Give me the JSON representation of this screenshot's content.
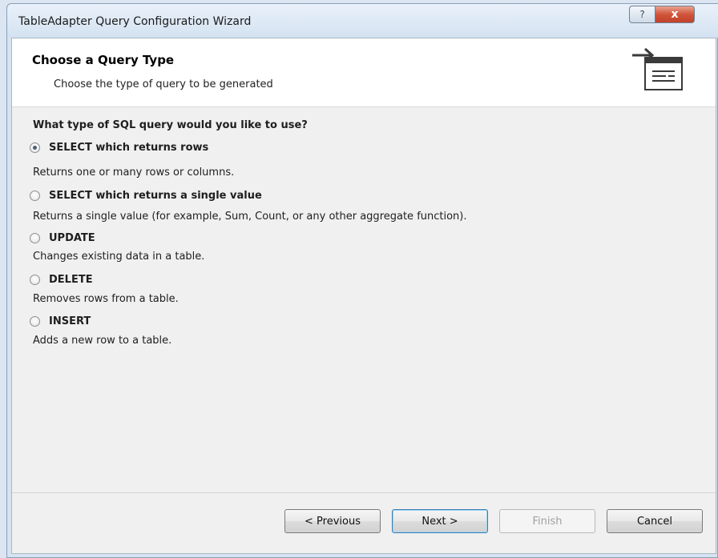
{
  "window": {
    "title": "TableAdapter Query Configuration Wizard",
    "help_glyph": "?",
    "close_glyph": "x"
  },
  "header": {
    "title": "Choose a Query Type",
    "subtitle": "Choose the type of query to be generated",
    "icon": "wizard-query-icon"
  },
  "content": {
    "question": "What type of SQL query would you like to use?",
    "selected_option": 0,
    "options": [
      {
        "label": "SELECT which returns rows",
        "description": "Returns one or many rows or columns."
      },
      {
        "label": "SELECT which returns a single value",
        "description": "Returns a single value (for example, Sum, Count, or any other aggregate function)."
      },
      {
        "label": "UPDATE",
        "description": "Changes existing data in a table."
      },
      {
        "label": "DELETE",
        "description": "Removes rows from a table."
      },
      {
        "label": "INSERT",
        "description": "Adds a new row to a table."
      }
    ]
  },
  "footer": {
    "previous_label": "< Previous",
    "next_label": "Next >",
    "finish_label": "Finish",
    "cancel_label": "Cancel"
  },
  "colors": {
    "window_frame": "#d6e4f2",
    "close_button": "#c2412a",
    "header_background": "#ffffff",
    "client_background": "#f0f0f0"
  }
}
